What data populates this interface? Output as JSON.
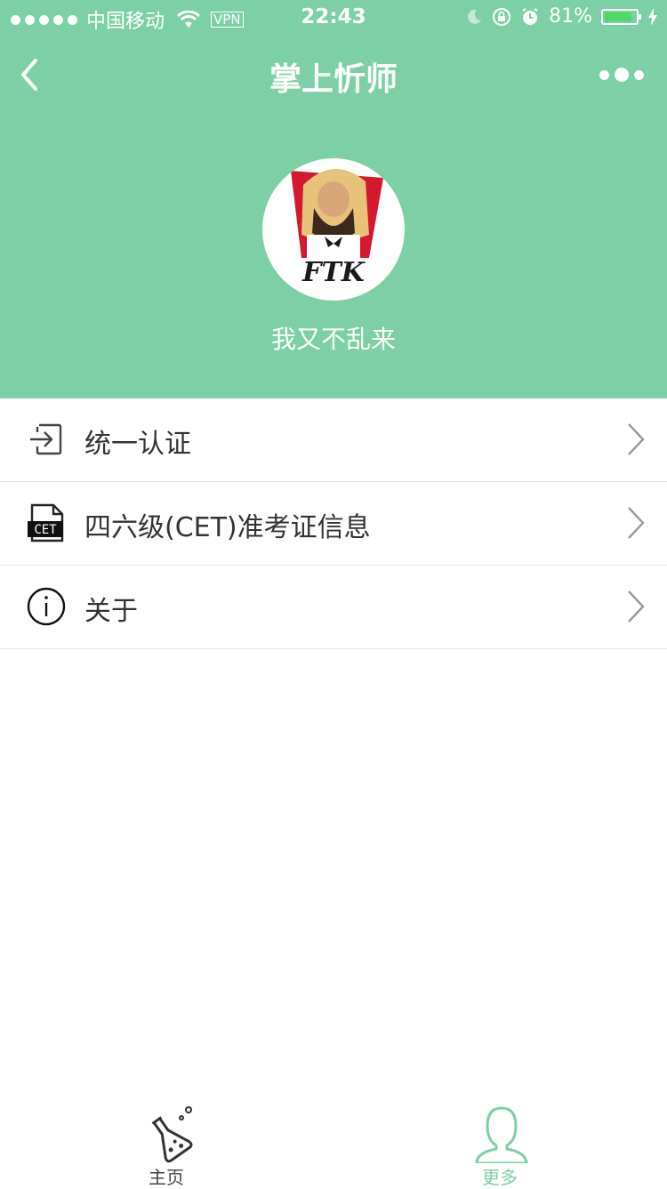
{
  "status_bar": {
    "carrier": "中国移动",
    "vpn": "VPN",
    "time": "22:43",
    "battery": "81%"
  },
  "nav": {
    "title": "掌上忻师"
  },
  "profile": {
    "name": "我又不乱来",
    "avatar_logo_text": "FTK"
  },
  "menu": [
    {
      "label": "统一认证",
      "icon": "login-icon"
    },
    {
      "label": "四六级(CET)准考证信息",
      "icon": "cet-document-icon"
    },
    {
      "label": "关于",
      "icon": "info-icon"
    }
  ],
  "tabbar": {
    "home_label": "主页",
    "more_label": "更多"
  },
  "colors": {
    "accent": "#7dcfa6",
    "battery": "#4cd964"
  }
}
